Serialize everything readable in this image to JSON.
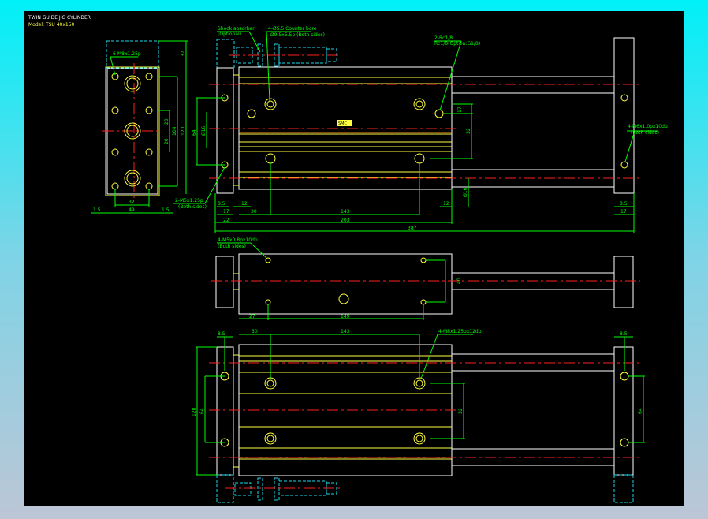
{
  "title": "TWIN GUIDE JIG CYLINDER",
  "model": "Model: TSU 40x150",
  "colors": {
    "background": "#000000",
    "outline": "#ffffff",
    "body_lines": "#ffff40",
    "dimensions": "#00ff00",
    "centerlines": "#ff2020",
    "hidden": "#20d8e8"
  },
  "side_view": {
    "note": "6-M8x1.25p",
    "dims": {
      "d37": "37",
      "d120": "120",
      "d104": "104",
      "d20a": "20",
      "d20b": "20",
      "d32": "32",
      "d49": "49",
      "d15a": "1.5",
      "d15b": "1.5"
    }
  },
  "top_view": {
    "note_shock": "Shock absorber",
    "note_shock_sub": "(Optional)",
    "note_counterbore": "4-Ø5.5 Counter bore",
    "note_counterbore_sub": "Ø9.5x5.5p (Both sides)",
    "note_port": "2-Rc1/8",
    "note_port_sub": "Rc1/8(Option:G1/8)",
    "note_m5": "2-M5x1.25p",
    "note_m5_sub": "(Both sides)",
    "note_right": "4-M6x1.0px10dp",
    "note_right_sub": "(Both sides)",
    "label_plate": "SMC",
    "dims": {
      "d64": "64",
      "d16": "Ø16",
      "d17": "17",
      "d32": "32",
      "d12a": "12",
      "d12b": "12",
      "d85a": "8.5",
      "d85b": "8.5",
      "d17a": "17",
      "d17b": "17",
      "d30": "30",
      "d143": "143",
      "d22": "22",
      "d203": "203",
      "d387": "387",
      "d16rod": "Ø16"
    }
  },
  "middle_view": {
    "note": "4-M5x0.8px10dp",
    "note_sub": "(Both sides)",
    "dims": {
      "d40": "40",
      "d27": "27",
      "d149": "149"
    }
  },
  "bottom_view": {
    "note": "4-M8x1.25px12dp",
    "dims": {
      "d85a": "8.5",
      "d85b": "8.5",
      "d30": "30",
      "d143": "143",
      "d120": "120",
      "d64a": "64",
      "d32": "32",
      "d64b": "64"
    }
  }
}
